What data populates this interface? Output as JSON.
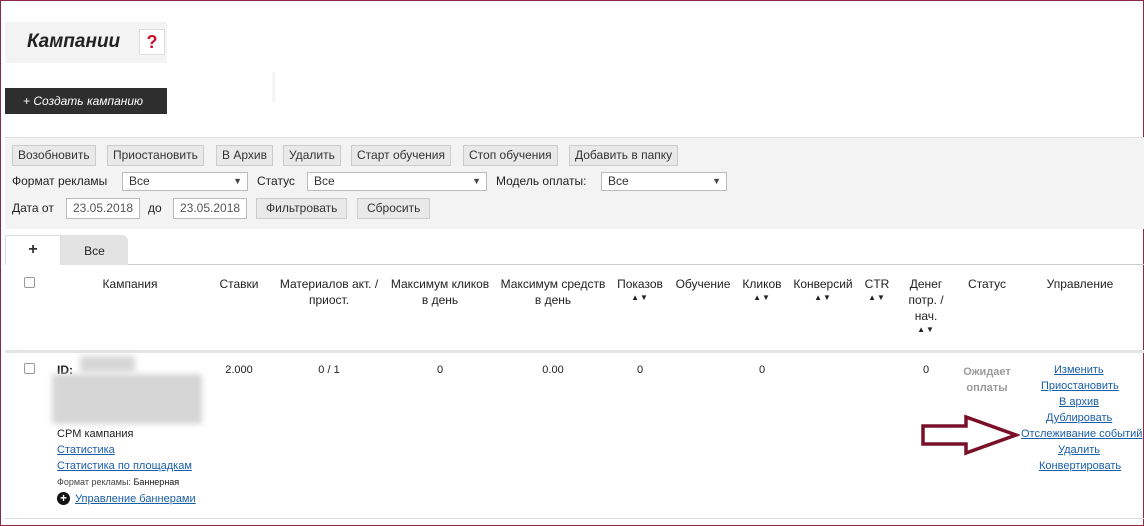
{
  "header": {
    "title": "Кампании",
    "help_label": "?"
  },
  "create_button": "+ Создать кампанию",
  "actions": [
    "Возобновить",
    "Приостановить",
    "В Архив",
    "Удалить",
    "Старт обучения",
    "Стоп обучения",
    "Добавить в папку"
  ],
  "filters": {
    "format_label": "Формат рекламы",
    "format_value": "Все",
    "status_label": "Статус",
    "status_value": "Все",
    "payment_label": "Модель оплаты:",
    "payment_value": "Все",
    "date_from_label": "Дата от",
    "date_from": "23.05.2018",
    "date_to_label": "до",
    "date_to": "23.05.2018",
    "filter_button": "Фильтровать",
    "reset_button": "Сбросить"
  },
  "tabs": {
    "add_label": "+",
    "all_label": "Все"
  },
  "columns": {
    "campaign": "Кампания",
    "bids": "Ставки",
    "materials": "Материалов акт. / приост.",
    "max_clicks": "Максимум кликов в день",
    "max_funds": "Максимум средств в день",
    "impressions": "Показов",
    "training": "Обучение",
    "clicks": "Кликов",
    "conversions": "Конверсий",
    "ctr": "CTR",
    "money": "Денег потр. / нач.",
    "status": "Статус",
    "management": "Управление"
  },
  "sort_glyph": "▲▼",
  "row": {
    "id_label": "ID:",
    "type": "CPM кампания",
    "stats_link": "Статистика",
    "site_stats_link": "Статистика по площадкам",
    "format_label": "Формат рекламы:",
    "format_value": "Баннерная",
    "banners_link": "Управление баннерами",
    "bids": "2.000",
    "materials": "0 / 1",
    "max_clicks": "0",
    "max_funds": "0.00",
    "impressions": "0",
    "clicks": "0",
    "money": "0",
    "status": "Ожидает оплаты",
    "actions": [
      "Изменить",
      "Приостановить",
      "В архив",
      "Дублировать",
      "Отслеживание событий",
      "Удалить",
      "Конвертировать"
    ]
  },
  "colors": {
    "arrow": "#7a1028",
    "dark_button": "#2e2e2e",
    "link": "#1a5ea8",
    "help": "#c8102e"
  }
}
